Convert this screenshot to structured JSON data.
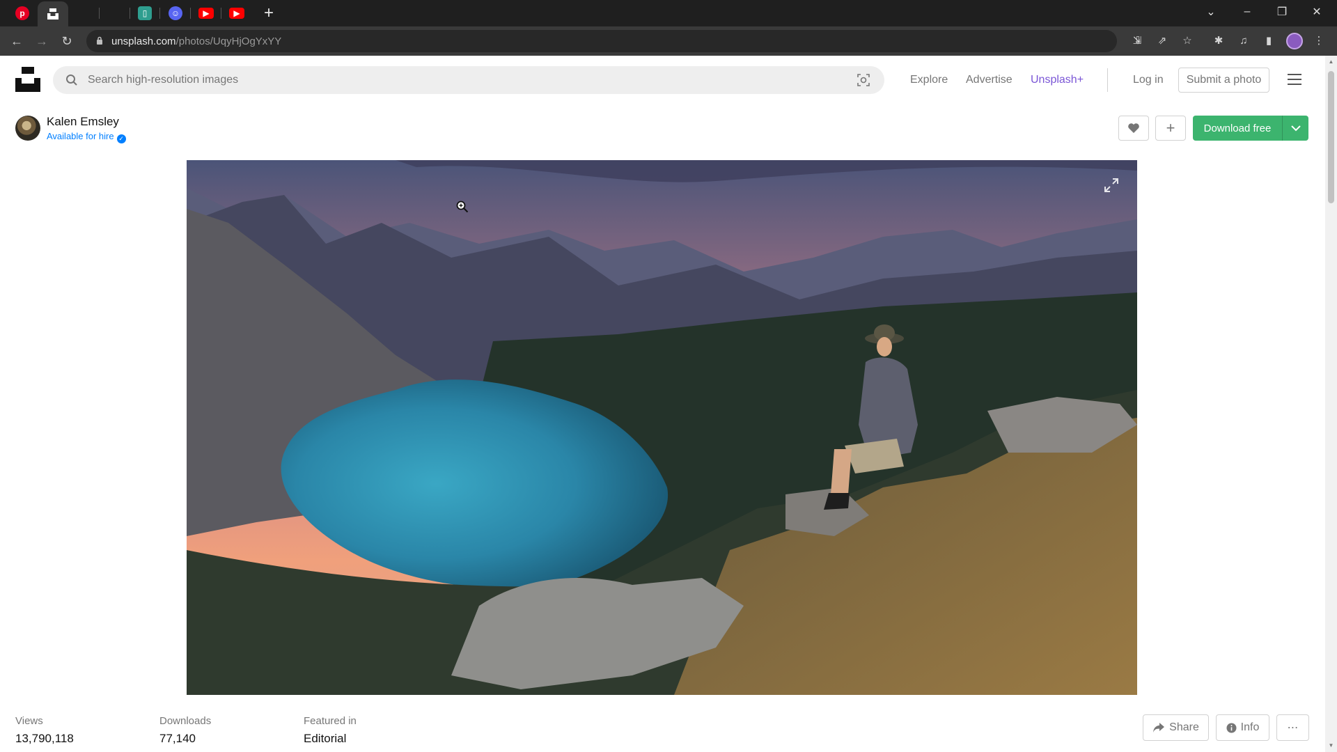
{
  "browser": {
    "tabs": [
      {
        "icon": "pinterest-icon",
        "color": "#e60023"
      },
      {
        "icon": "unsplash-icon",
        "color": "#ffffff",
        "active": true
      },
      {
        "icon": "blank-icon",
        "color": "#1f1f1f"
      },
      {
        "icon": "blank-icon",
        "color": "#1f1f1f"
      },
      {
        "icon": "doc-icon",
        "color": "#2f9e8f"
      },
      {
        "icon": "discord-icon",
        "color": "#5865f2"
      },
      {
        "icon": "youtube-icon",
        "color": "#ff0000"
      },
      {
        "icon": "youtube-icon",
        "color": "#ff0000"
      }
    ],
    "url_host": "unsplash.com",
    "url_path": "/photos/UqyHjOgYxYY"
  },
  "header": {
    "search_placeholder": "Search high-resolution images",
    "nav": {
      "explore": "Explore",
      "advertise": "Advertise",
      "unsplash_plus": "Unsplash+",
      "login": "Log in",
      "submit": "Submit a photo"
    }
  },
  "author": {
    "name": "Kalen Emsley",
    "status": "Available for hire"
  },
  "actions": {
    "download": "Download free"
  },
  "stats": [
    {
      "label": "Views",
      "value": "13,790,118"
    },
    {
      "label": "Downloads",
      "value": "77,140"
    },
    {
      "label": "Featured in",
      "value": "Editorial"
    }
  ],
  "footer_actions": {
    "share": "Share",
    "info": "Info"
  },
  "colors": {
    "accent_green": "#3cb46e",
    "unsplash_plus": "#7a55d6",
    "hire_blue": "#007fff"
  }
}
